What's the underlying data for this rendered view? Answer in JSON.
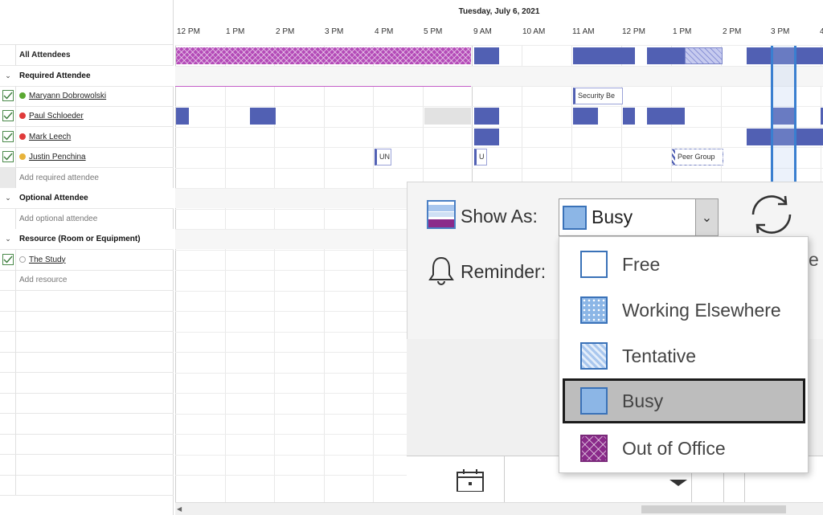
{
  "date_header": "Tuesday, July 6, 2021",
  "times": [
    "12 PM",
    "1 PM",
    "2 PM",
    "3 PM",
    "4 PM",
    "5 PM",
    "9 AM",
    "10 AM",
    "11 AM",
    "12 PM",
    "1 PM",
    "2 PM",
    "3 PM",
    "4"
  ],
  "attendees": {
    "all_label": "All Attendees",
    "required_group": "Required Attendee",
    "required": [
      {
        "name": "Maryann Dobrowolski",
        "status_color": "#5aa832"
      },
      {
        "name": "Paul Schloeder",
        "status_color": "#e03a3a"
      },
      {
        "name": "Mark Leech",
        "status_color": "#e03a3a"
      },
      {
        "name": "Justin Penchina",
        "status_color": "#e8b33a"
      }
    ],
    "add_required": "Add required attendee",
    "optional_group": "Optional Attendee",
    "add_optional": "Add optional attendee",
    "resource_group": "Resource (Room or Equipment)",
    "resources": [
      {
        "name": "The Study"
      }
    ],
    "add_resource": "Add resource"
  },
  "meetings": {
    "security": "Security Be",
    "un1": "UN",
    "un2": "U",
    "peer": "Peer Group"
  },
  "options_panel": {
    "show_as_label": "Show As:",
    "show_as_value": "Busy",
    "reminder_label": "Reminder:",
    "right_edge_char": "e"
  },
  "show_as_options": [
    {
      "label": "Free",
      "icon": "free"
    },
    {
      "label": "Working Elsewhere",
      "icon": "work"
    },
    {
      "label": "Tentative",
      "icon": "tent"
    },
    {
      "label": "Busy",
      "icon": "busy",
      "selected": true
    },
    {
      "label": "Out of Office",
      "icon": "ooo"
    }
  ],
  "colors": {
    "busy": "#5160b3",
    "out_of_office": "#b44bb8",
    "selection_outline": "#3a7fd0"
  }
}
